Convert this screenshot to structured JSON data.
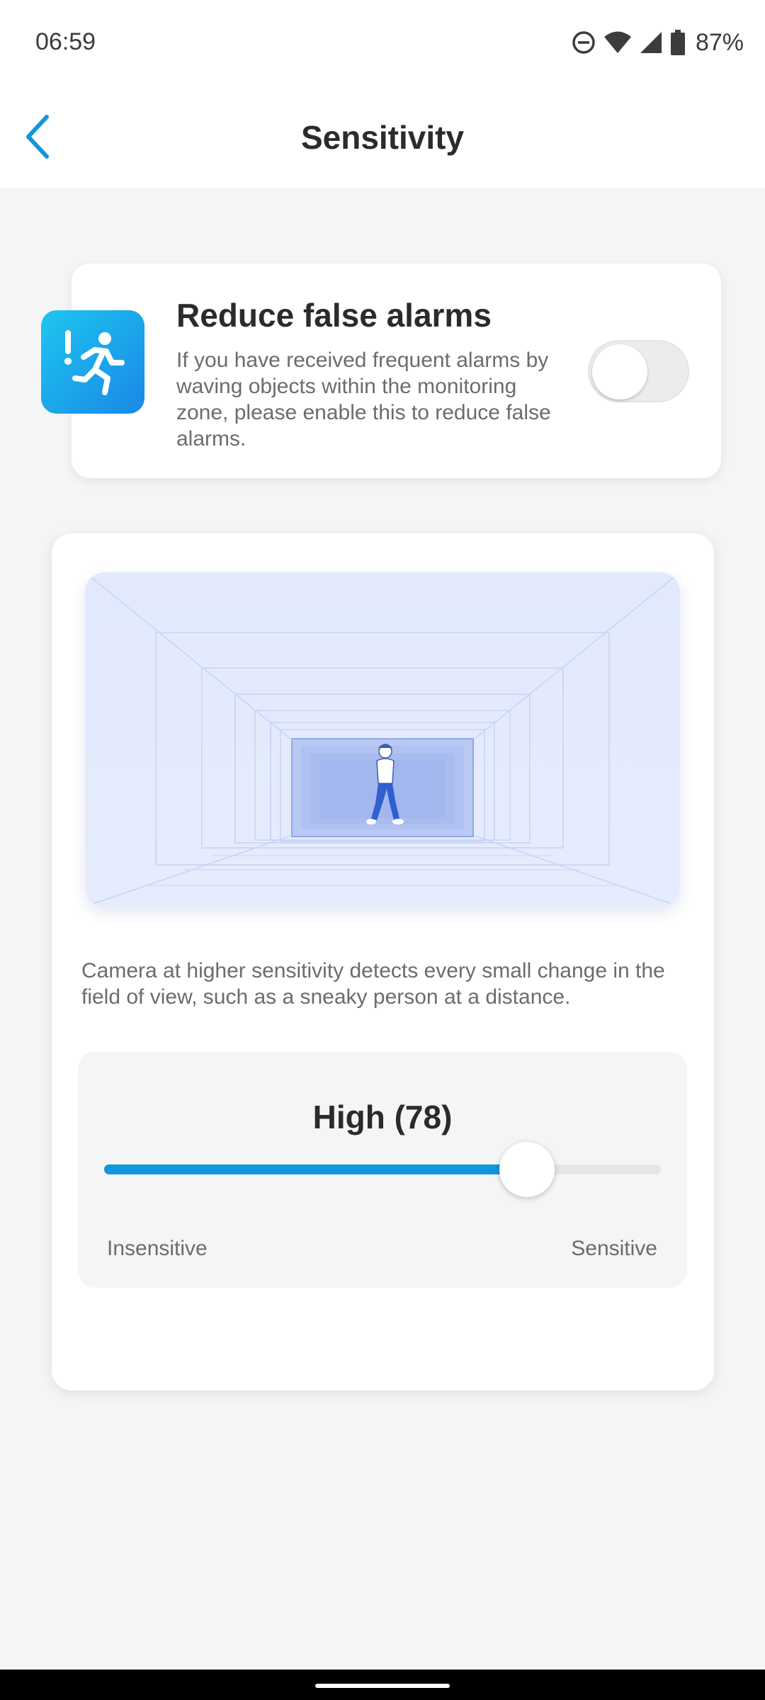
{
  "status_bar": {
    "time": "06:59",
    "battery_percent": "87%",
    "icons": [
      "do-not-disturb-icon",
      "wifi-icon",
      "cell-signal-icon",
      "battery-icon"
    ]
  },
  "header": {
    "title": "Sensitivity",
    "back_icon": "chevron-left-icon",
    "accent_color": "#1296db"
  },
  "false_alarm": {
    "title": "Reduce false alarms",
    "description": "If you have received frequent alarms by waving objects within the monitoring zone, please enable this to reduce false alarms.",
    "icon": "running-person-alert-icon",
    "enabled": false
  },
  "sensitivity": {
    "description": "Camera at higher sensitivity detects every small change in the field of view, such as a sneaky person at a distance.",
    "level_label": "High (78)",
    "value": 78,
    "min": 0,
    "max": 100,
    "slider_fill_fraction": 0.76,
    "min_label": "Insensitive",
    "max_label": "Sensitive"
  }
}
